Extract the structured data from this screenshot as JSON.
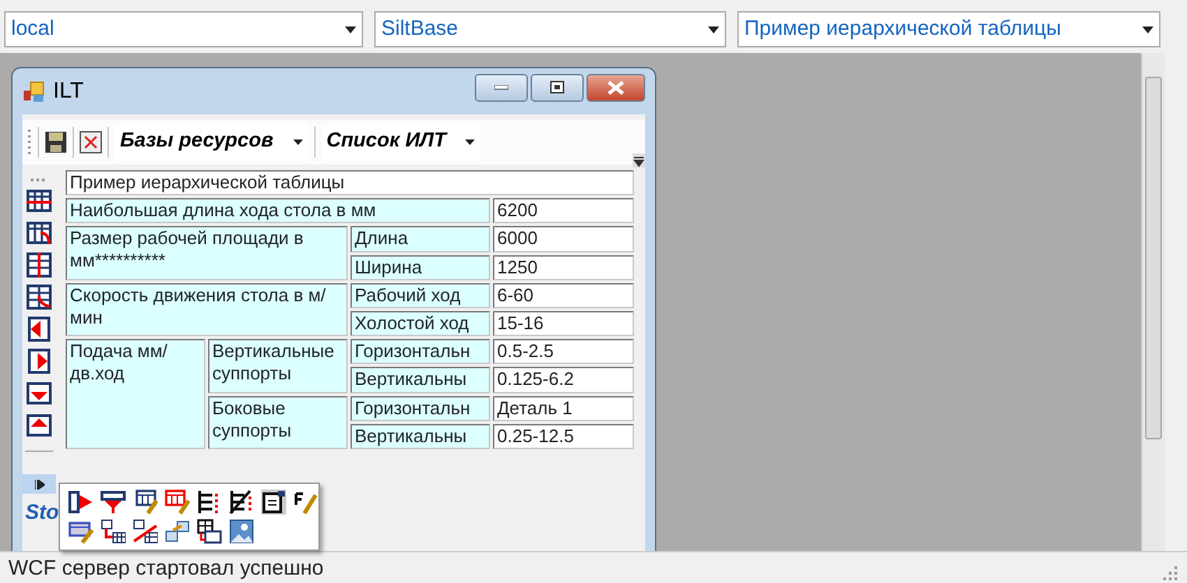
{
  "selectors": [
    {
      "value": "local"
    },
    {
      "value": "SiltBase"
    },
    {
      "value": "Пример иерархической таблицы"
    }
  ],
  "window": {
    "title": "ILT"
  },
  "toolbar": {
    "dropdowns": [
      {
        "label": "Базы ресурсов"
      },
      {
        "label": "Список ИЛТ"
      }
    ]
  },
  "table": {
    "title": "Пример иерархической таблицы",
    "rows": [
      {
        "label": "Наибольшая длина хода стола в мм",
        "value": "6200"
      },
      {
        "label": "Размер рабочей площади в мм**********",
        "children": [
          {
            "label": "Длина",
            "value": "6000"
          },
          {
            "label": "Ширина",
            "value": "1250"
          }
        ]
      },
      {
        "label": "Скорость движения стола в м/мин",
        "children": [
          {
            "label": "Рабочий ход",
            "value": "6-60"
          },
          {
            "label": "Холостой ход",
            "value": "15-16"
          }
        ]
      },
      {
        "label": "Подача мм/дв.ход",
        "children": [
          {
            "label": "Вертикальные суппорты",
            "children": [
              {
                "label": "Горизонтальн",
                "value": "0.5-2.5"
              },
              {
                "label": "Вертикальны",
                "value": "0.125-6.2"
              }
            ]
          },
          {
            "label": "Боковые суппорты",
            "children": [
              {
                "label": "Горизонтальн",
                "value": "Деталь 1"
              },
              {
                "label": "Вертикальны",
                "value": "0.25-12.5"
              }
            ]
          }
        ]
      }
    ]
  },
  "bottom_tab": {
    "label": "Sto"
  },
  "status_bar": {
    "text": "WCF сервер стартовал успешно"
  }
}
